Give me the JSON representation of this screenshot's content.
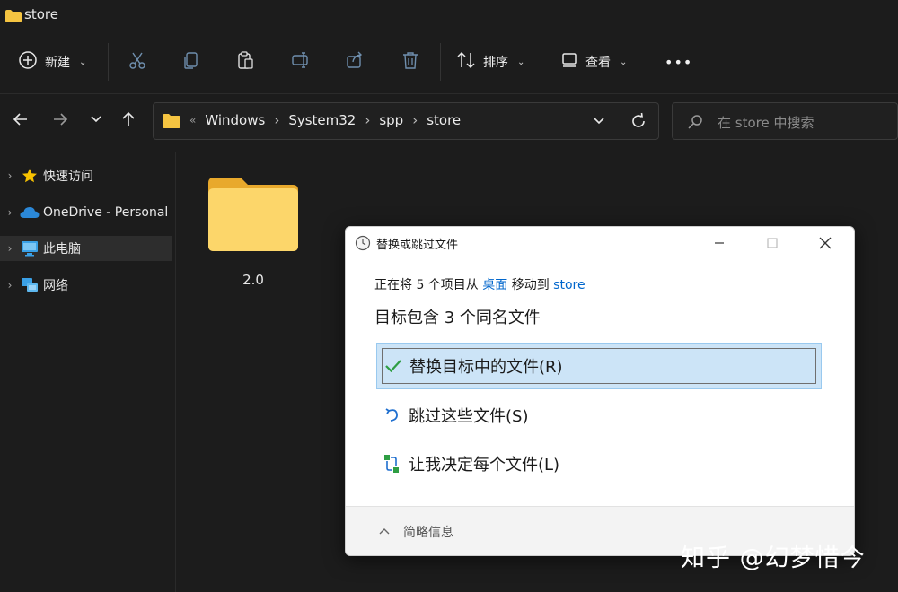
{
  "window": {
    "title": "store"
  },
  "toolbar": {
    "new_label": "新建",
    "sort_label": "排序",
    "view_label": "查看",
    "more_label": "•••"
  },
  "address": {
    "crumbs": [
      "Windows",
      "System32",
      "spp",
      "store"
    ],
    "overflow": "«"
  },
  "search": {
    "placeholder": "在 store 中搜索"
  },
  "nav": {
    "items": [
      {
        "label": "快速访问",
        "icon": "star-icon"
      },
      {
        "label": "OneDrive - Personal",
        "icon": "cloud-icon"
      },
      {
        "label": "此电脑",
        "icon": "computer-icon",
        "selected": true
      },
      {
        "label": "网络",
        "icon": "network-icon"
      }
    ]
  },
  "content": {
    "items": [
      {
        "label": "2.0",
        "icon": "folder-icon"
      }
    ]
  },
  "dialog": {
    "title": "替换或跳过文件",
    "line1_prefix": "正在将 5 个项目从 ",
    "source": "桌面",
    "line1_mid": " 移动到 ",
    "destination": "store",
    "line2": "目标包含 3 个同名文件",
    "options": [
      {
        "label": "替换目标中的文件(R)",
        "icon": "check-icon",
        "selected": true
      },
      {
        "label": "跳过这些文件(S)",
        "icon": "skip-icon"
      },
      {
        "label": "让我决定每个文件(L)",
        "icon": "decide-icon"
      }
    ],
    "details_label": "简略信息"
  },
  "watermark": "知乎 @幻梦惜今"
}
